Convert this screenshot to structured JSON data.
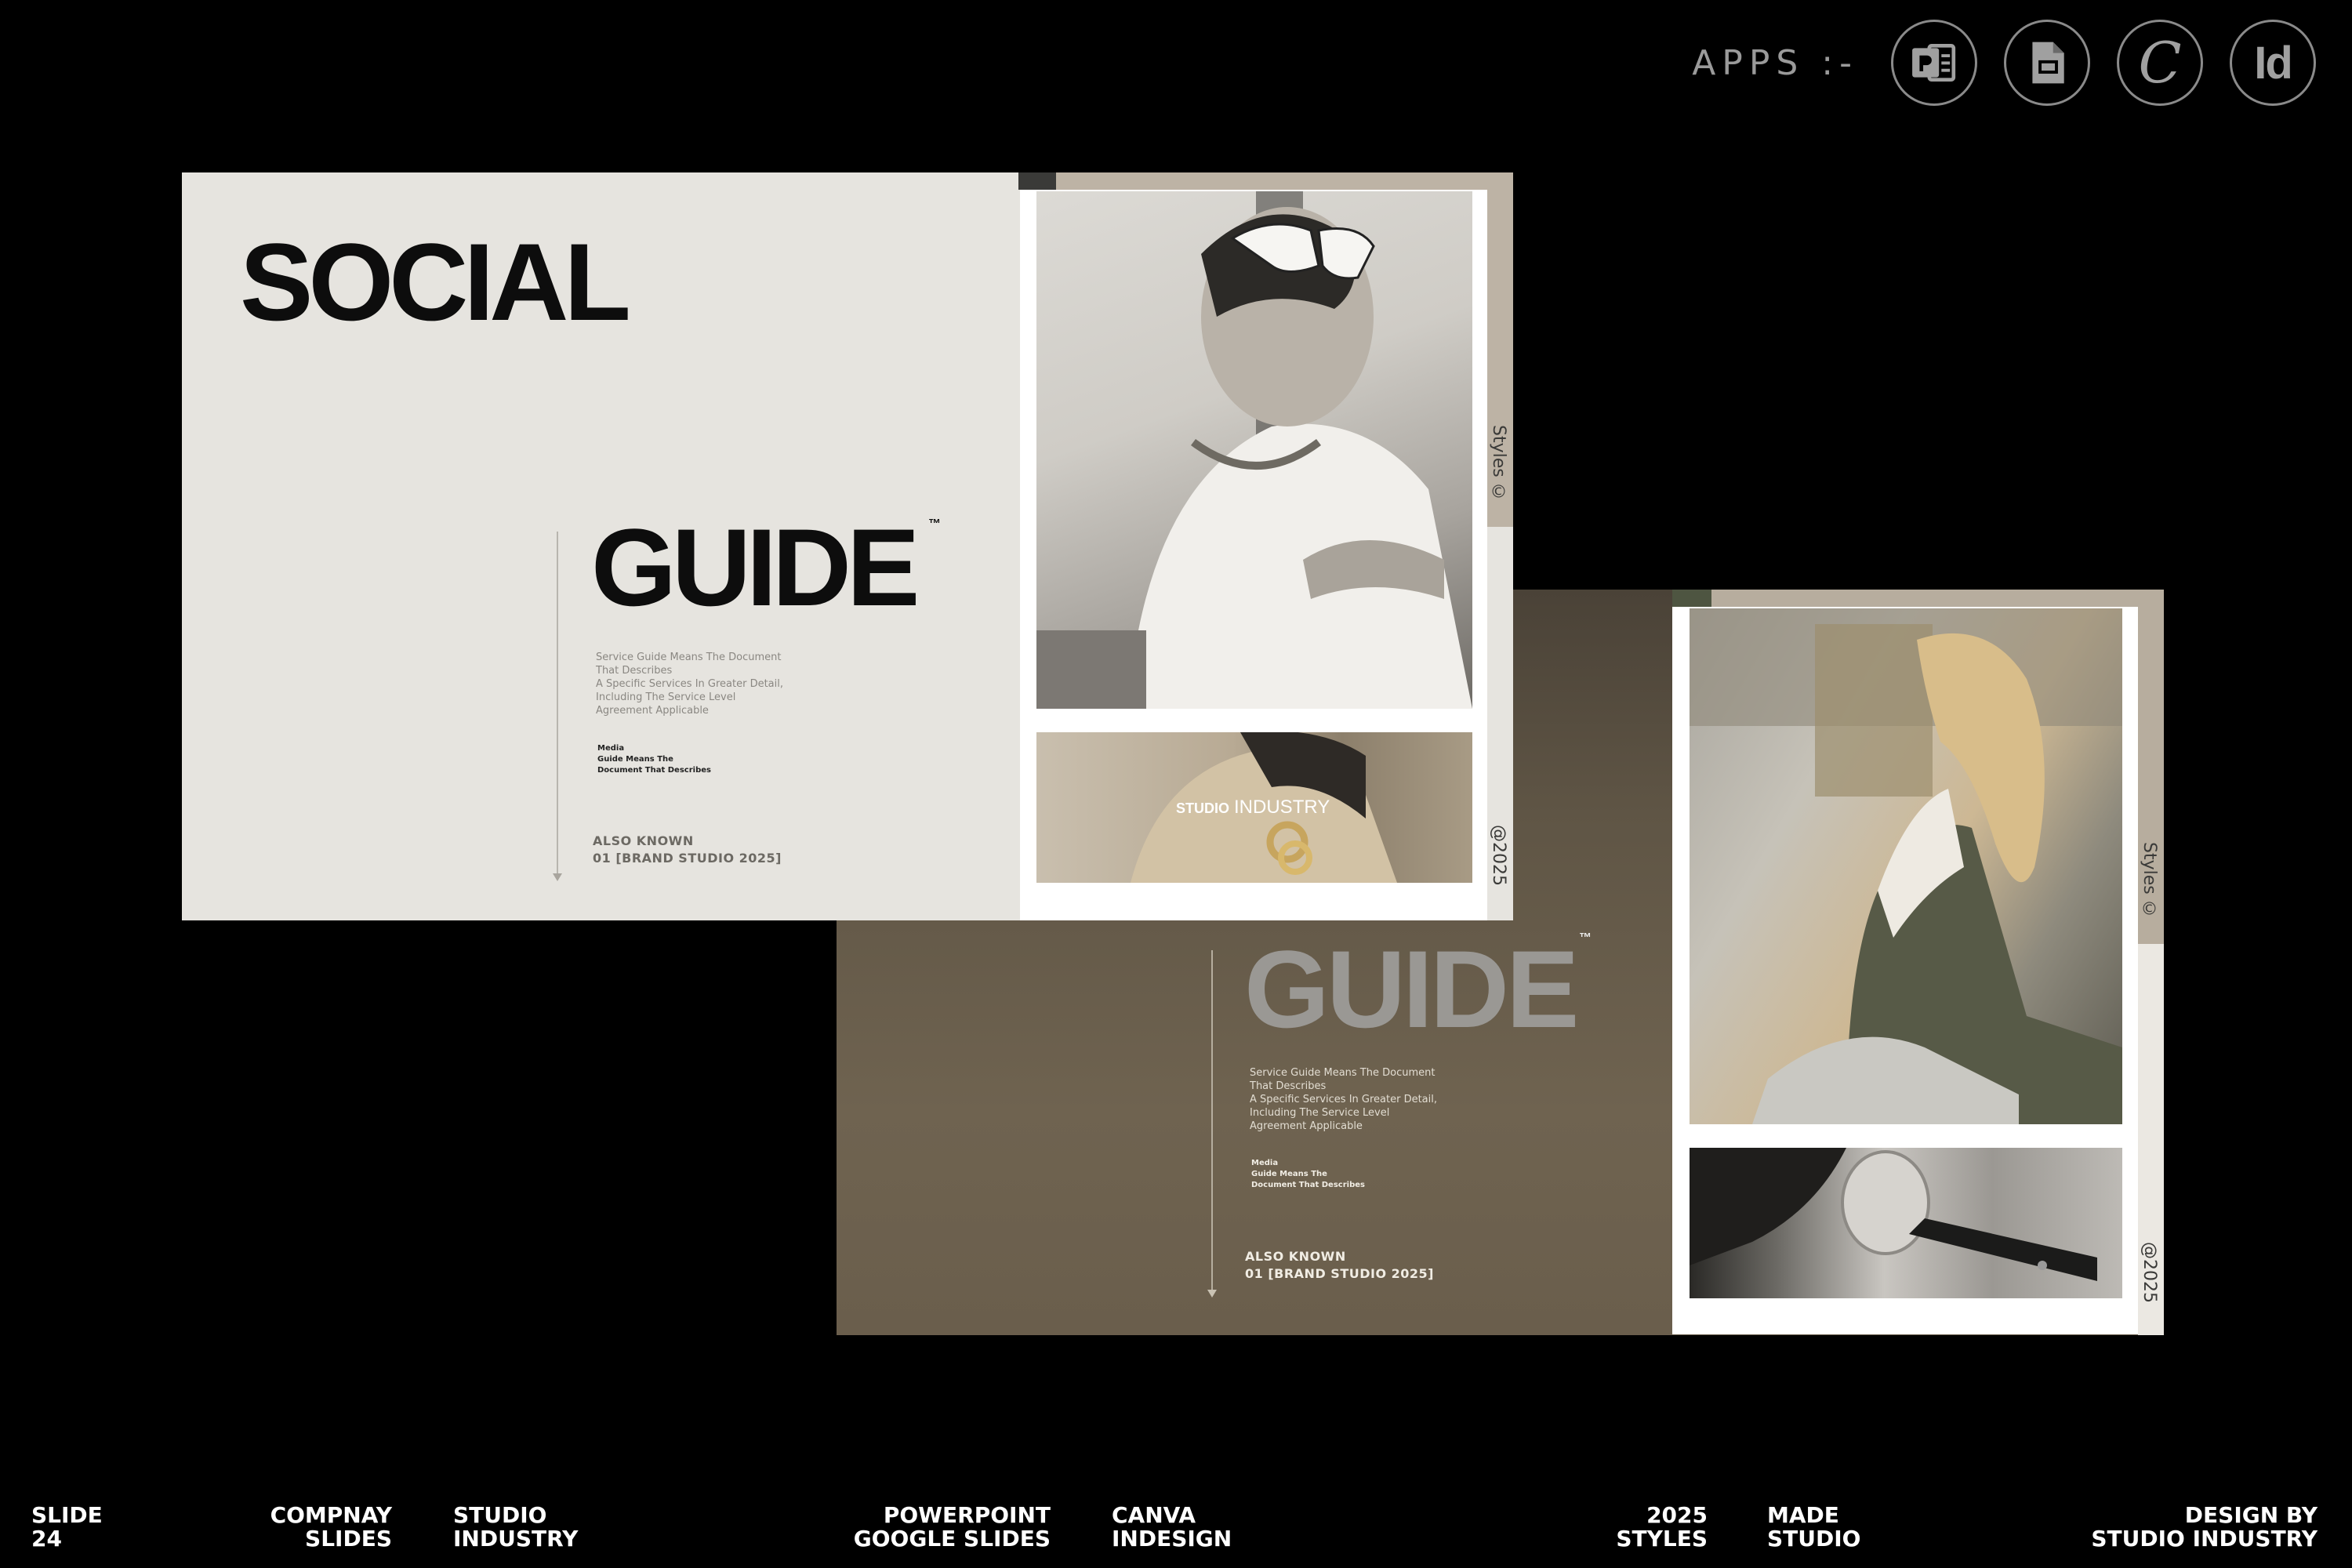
{
  "apps": {
    "label": "APPS :-",
    "icons": [
      "powerpoint-icon",
      "google-slides-icon",
      "canva-icon",
      "indesign-icon"
    ],
    "canva_glyph": "C",
    "indesign_glyph": "Id"
  },
  "slide_a": {
    "title_line1": "SOCIAL",
    "title_line2": "GUIDE",
    "tm": "™",
    "description": [
      "Service Guide Means The Document",
      "That Describes",
      "A Specific Services In Greater Detail,",
      "Including The Service Level",
      "Agreement Applicable"
    ],
    "media": [
      "Media",
      "Guide Means The",
      "Document That Describes"
    ],
    "known": [
      "ALSO  KNOWN",
      "01 [BRAND STUDIO 2025]"
    ],
    "styles_label": "Styles ©",
    "year_label": "@2025",
    "overlay_bold": "STUDIO",
    "overlay_light": "INDUSTRY"
  },
  "slide_b": {
    "title": "GUIDE",
    "tm": "™",
    "description": [
      "Service Guide Means The Document",
      "That Describes",
      "A Specific Services In Greater Detail,",
      "Including The Service Level",
      "Agreement Applicable"
    ],
    "media": [
      "Media",
      "Guide Means The",
      "Document That Describes"
    ],
    "known": [
      "ALSO  KNOWN",
      "01 [BRAND STUDIO 2025]"
    ],
    "styles_label": "Styles ©",
    "year_label": "@2025"
  },
  "footer": {
    "slide": [
      "SLIDE",
      "24"
    ],
    "company": [
      "COMPNAY",
      "SLIDES"
    ],
    "studio": [
      "STUDIO",
      "INDUSTRY"
    ],
    "software1": [
      "POWERPOINT",
      "GOOGLE SLIDES"
    ],
    "software2": [
      "CANVA",
      "INDESIGN"
    ],
    "year": [
      "2025",
      "STYLES"
    ],
    "made": [
      "MADE",
      "STUDIO"
    ],
    "design": [
      "DESIGN BY",
      "STUDIO INDUSTRY"
    ]
  },
  "colors": {
    "background": "#000000",
    "slide_light": "#e6e4df",
    "slide_dark": "#6a5e4c",
    "accent_tan": "#bdb3a5"
  }
}
